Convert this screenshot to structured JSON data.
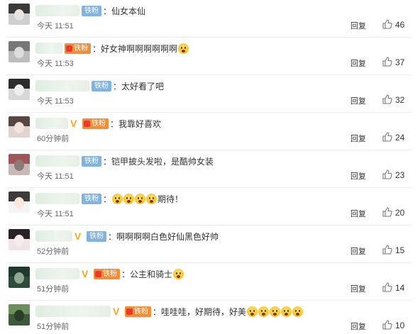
{
  "comments": [
    {
      "badge": "铁粉",
      "badge_type": "fan",
      "vip": "",
      "text": "：仙女本仙",
      "emoji_after": 0,
      "time": "今天 11:51",
      "reply": "回复",
      "likes": "46"
    },
    {
      "badge": "铁粉",
      "badge_type": "gold",
      "vip": "",
      "text": "：好女神啊啊啊啊啊啊",
      "emoji_after": 1,
      "time": "今天 11:53",
      "reply": "回复",
      "likes": "37"
    },
    {
      "badge": "铁粉",
      "badge_type": "fan",
      "vip": "",
      "text": "：太好看了吧",
      "emoji_after": 0,
      "time": "今天 11:53",
      "reply": "回复",
      "likes": "32"
    },
    {
      "badge": "铁粉",
      "badge_type": "gold",
      "vip": "V",
      "text": "：我靠好喜欢",
      "emoji_after": 0,
      "time": "60分钟前",
      "reply": "回复",
      "likes": "24"
    },
    {
      "badge": "铁粉",
      "badge_type": "fan",
      "vip": "",
      "text": "：铠甲披头发啦，是酷帅女装",
      "emoji_after": 0,
      "time": "今天 11:51",
      "reply": "回复",
      "likes": "23"
    },
    {
      "badge": "铁粉",
      "badge_type": "fan",
      "vip": "",
      "text": "期待！",
      "emoji_before": 4,
      "time": "今天 11:51",
      "reply": "回复",
      "likes": "20"
    },
    {
      "badge": "铁粉",
      "badge_type": "fan",
      "vip": "V",
      "text": "：啊啊啊啊白色好仙黑色好帅",
      "emoji_after": 0,
      "time": "52分钟前",
      "reply": "回复",
      "likes": "15"
    },
    {
      "badge": "铁粉",
      "badge_type": "gold",
      "vip": "V",
      "text": "：公主和骑士",
      "emoji_after": 1,
      "time": "51分钟前",
      "reply": "回复",
      "likes": "14"
    },
    {
      "badge": "铁粉",
      "badge_type": "gold",
      "vip": "V",
      "text": "：哇哇哇，好期待，好美",
      "emoji_after": 5,
      "time": "51分钟前",
      "reply": "回复",
      "likes": "10"
    }
  ],
  "colors": {
    "fan_badge": "#81b3dc",
    "gold_badge": "#f18e3a",
    "vip": "#f5a623"
  }
}
